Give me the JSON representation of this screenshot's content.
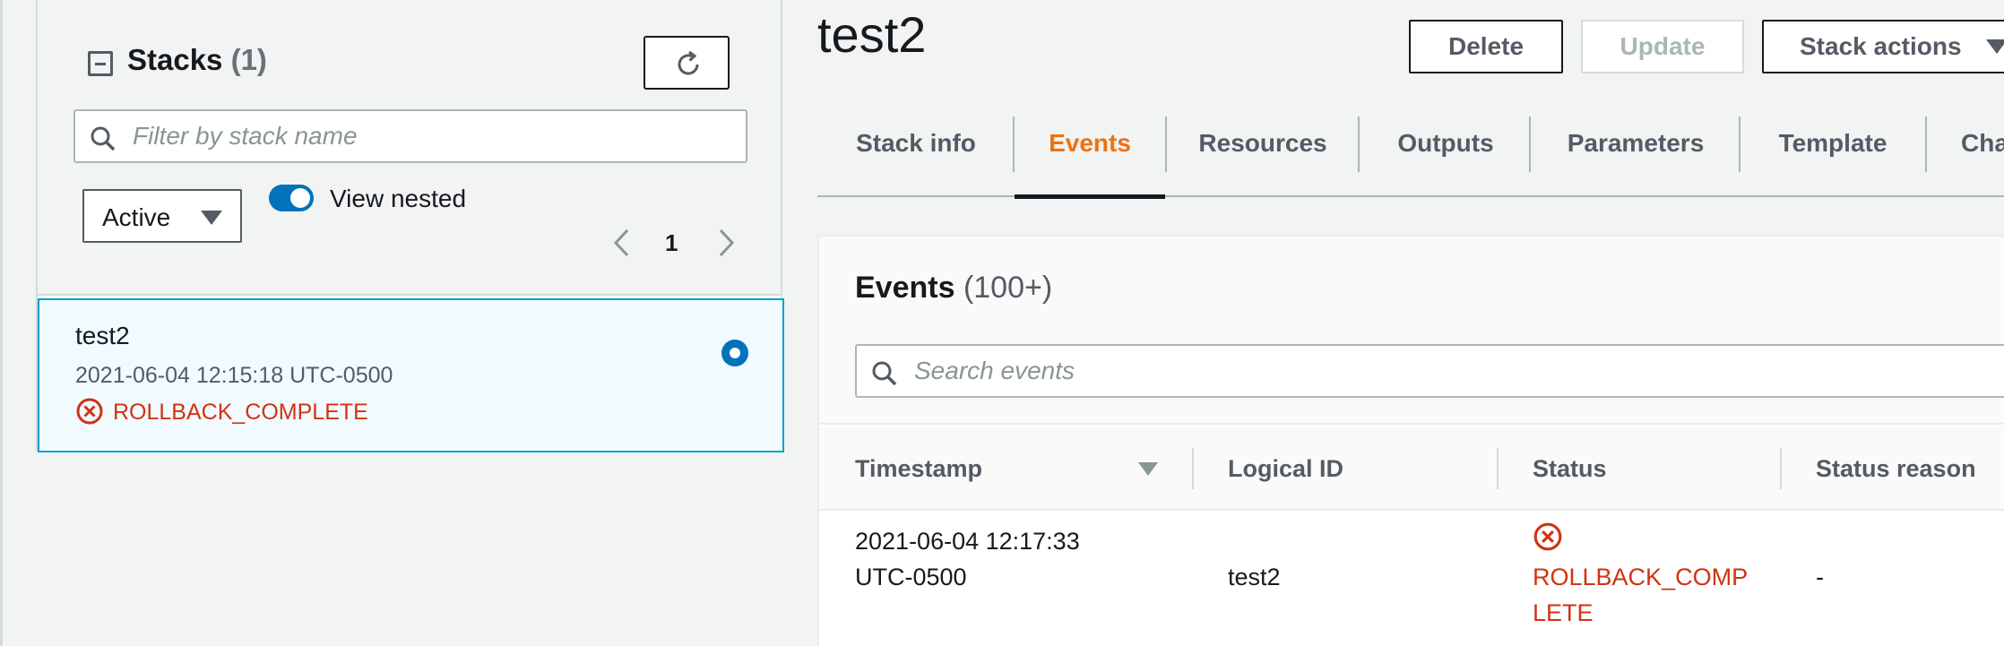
{
  "stacks_panel": {
    "title": "Stacks",
    "count": "(1)",
    "search_placeholder": "Filter by stack name",
    "status_filter": "Active",
    "view_nested_label": "View nested",
    "page_number": "1",
    "items": [
      {
        "name": "test2",
        "created": "2021-06-04 12:15:18 UTC-0500",
        "status": "ROLLBACK_COMPLETE",
        "selected": true
      }
    ]
  },
  "detail": {
    "title": "test2",
    "buttons": {
      "delete": "Delete",
      "update": "Update",
      "stack_actions": "Stack actions"
    },
    "tabs": [
      "Stack info",
      "Events",
      "Resources",
      "Outputs",
      "Parameters",
      "Template",
      "Cha"
    ],
    "active_tab": "Events"
  },
  "events": {
    "title": "Events",
    "count": "(100+)",
    "search_placeholder": "Search events",
    "columns": [
      "Timestamp",
      "Logical ID",
      "Status",
      "Status reason"
    ],
    "rows": [
      {
        "timestamp_line1": "2021-06-04 12:17:33",
        "timestamp_line2": "UTC-0500",
        "logical_id": "test2",
        "status_line1": "ROLLBACK_COMP",
        "status_line2": "LETE",
        "status_reason": "-"
      }
    ]
  },
  "colors": {
    "accent": "#0073bb",
    "active_tab": "#ec7211",
    "error": "#d13212"
  },
  "icons": [
    "collapse-icon",
    "refresh-icon",
    "search-icon",
    "chevron-left-icon",
    "chevron-right-icon",
    "error-circle-icon",
    "caret-down-icon"
  ]
}
